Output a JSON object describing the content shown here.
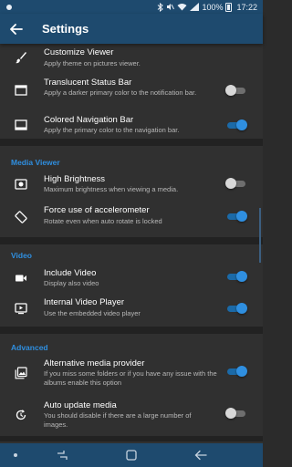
{
  "status_bar": {
    "battery": "100%",
    "time": "17:22"
  },
  "app_bar": {
    "title": "Settings"
  },
  "sections": {
    "theme_items": [
      {
        "title": "Customize Viewer",
        "summary": "Apply theme on pictures viewer.",
        "icon": "brush-icon"
      },
      {
        "title": "Translucent Status Bar",
        "summary": "Apply a darker primary color to the notification bar.",
        "icon": "status-bar-icon",
        "checked": false
      },
      {
        "title": "Colored Navigation Bar",
        "summary": "Apply the primary color to the navigation bar.",
        "icon": "navigation-bar-icon",
        "checked": true
      }
    ],
    "media_viewer": {
      "header": "Media Viewer",
      "items": [
        {
          "title": "High Brightness",
          "summary": "Maximum brightness when viewing a media.",
          "icon": "brightness-icon",
          "checked": false
        },
        {
          "title": "Force use of accelerometer",
          "summary": "Rotate even when auto rotate is locked",
          "icon": "screen-rotation-icon",
          "checked": true
        }
      ]
    },
    "video": {
      "header": "Video",
      "items": [
        {
          "title": "Include Video",
          "summary": "Display also video",
          "icon": "videocam-icon",
          "checked": true
        },
        {
          "title": "Internal Video Player",
          "summary": "Use the embedded video player",
          "icon": "video-player-icon",
          "checked": true
        }
      ]
    },
    "advanced": {
      "header": "Advanced",
      "items": [
        {
          "title": "Alternative media provider",
          "summary": "If you miss some folders or if you have any issue with the albums enable this option",
          "icon": "photo-library-icon",
          "checked": true
        },
        {
          "title": "Auto update media",
          "summary": "You should disable if there are a large number of images.",
          "icon": "auto-update-icon",
          "checked": false
        }
      ]
    }
  },
  "colors": {
    "primary": "#1e4a6e",
    "accent": "#2f8fe0",
    "card": "#303030",
    "background": "#222222"
  }
}
